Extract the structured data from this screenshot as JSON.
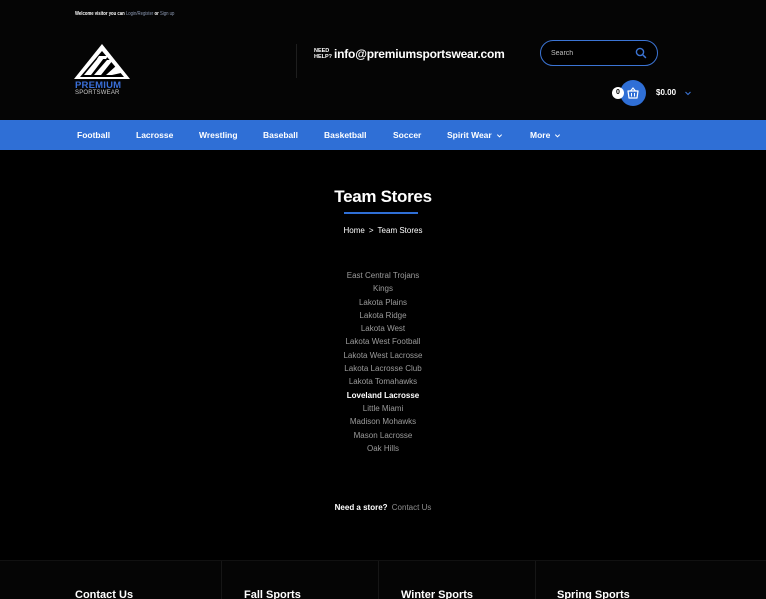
{
  "header": {
    "welcome": {
      "prefix": "Welcome visitor you can",
      "login_link": "Login/Register",
      "or": "or",
      "signup_link": "Sign up"
    },
    "logo": {
      "line1": "PREMIUM",
      "line2": "SPORTSWEAR"
    },
    "help": {
      "label": "NEED HELP?",
      "email": "info@premiumsportswear.com"
    },
    "search": {
      "placeholder": "Search"
    },
    "cart": {
      "count": "0",
      "total": "$0.00"
    },
    "colors": {
      "accent": "#2f6fd6",
      "background": "#000000"
    }
  },
  "nav": {
    "items": [
      {
        "label": "Football"
      },
      {
        "label": "Lacrosse"
      },
      {
        "label": "Wrestling"
      },
      {
        "label": "Baseball"
      },
      {
        "label": "Basketball"
      },
      {
        "label": "Soccer"
      },
      {
        "label": "Spirit Wear"
      },
      {
        "label": "More"
      }
    ]
  },
  "main": {
    "title": "Team Stores",
    "breadcrumb": {
      "home": "Home",
      "separator": ">",
      "current": "Team Stores"
    },
    "stores": [
      {
        "name": "East Central Trojans"
      },
      {
        "name": "Kings"
      },
      {
        "name": "Lakota Plains"
      },
      {
        "name": "Lakota Ridge"
      },
      {
        "name": "Lakota West"
      },
      {
        "name": "Lakota West Football"
      },
      {
        "name": "Lakota West Lacrosse"
      },
      {
        "name": "Lakota Lacrosse Club"
      },
      {
        "name": "Lakota Tomahawks"
      },
      {
        "name": "Loveland Lacrosse"
      },
      {
        "name": "Little Miami"
      },
      {
        "name": "Madison Mohawks"
      },
      {
        "name": "Mason Lacrosse"
      },
      {
        "name": "Oak Hills"
      }
    ],
    "need_store": {
      "label": "Need a store?",
      "link": "Contact Us"
    }
  },
  "footer": {
    "columns": [
      {
        "heading": "Contact Us"
      },
      {
        "heading": "Fall Sports"
      },
      {
        "heading": "Winter Sports"
      },
      {
        "heading": "Spring Sports"
      }
    ]
  }
}
